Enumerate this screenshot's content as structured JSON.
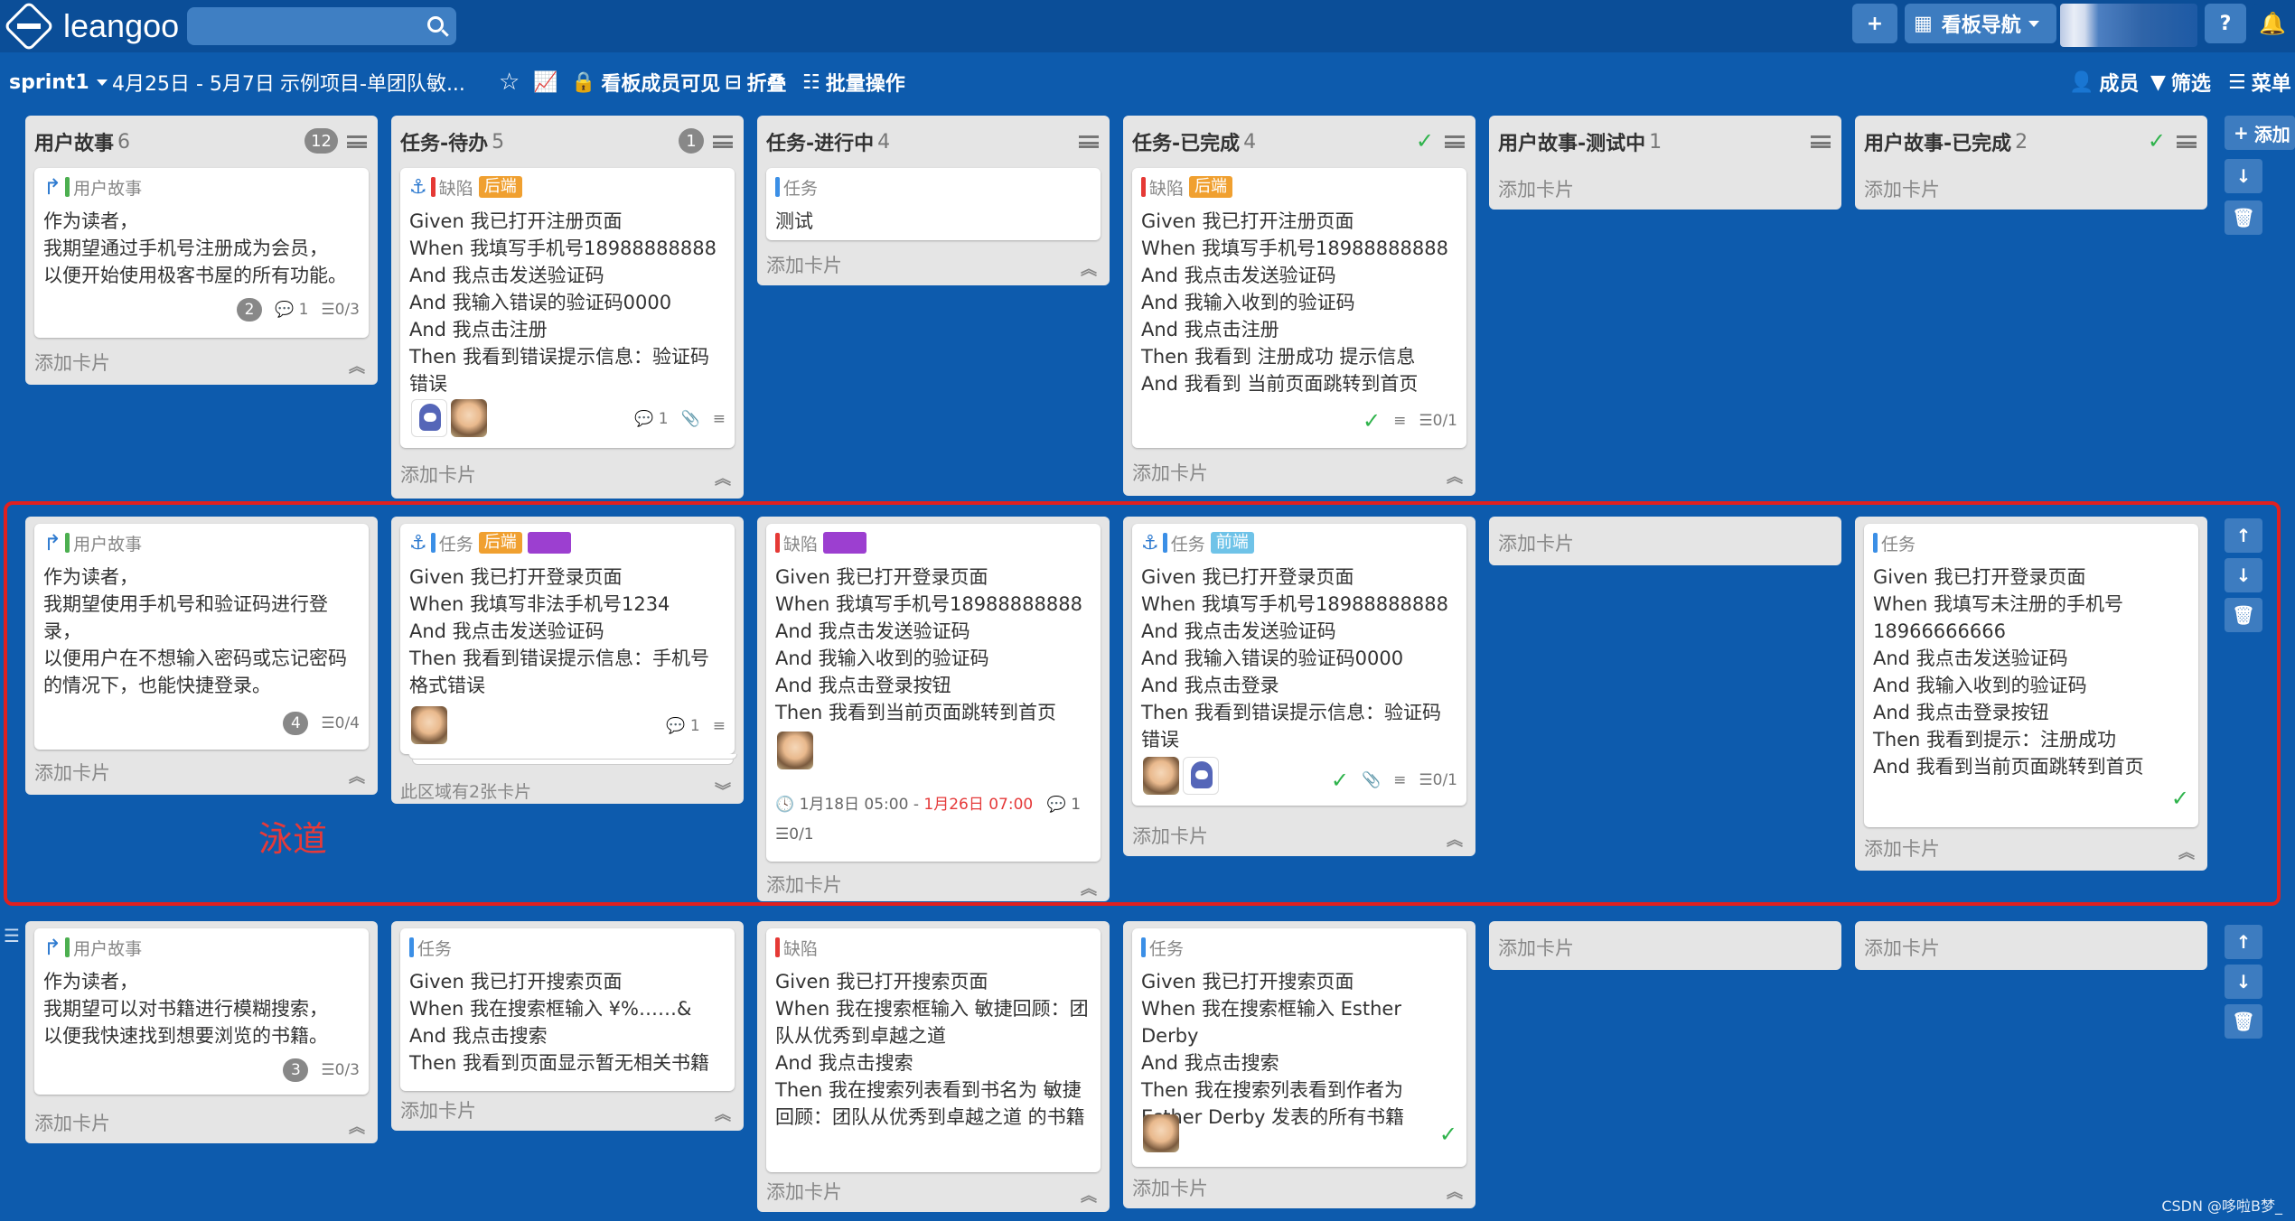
{
  "app": {
    "logo_text": "leangoo"
  },
  "topbar": {
    "add_label": "+",
    "grid_label": "▦",
    "nav_label": "看板导航",
    "help_label": "?",
    "bell_label": "🔔"
  },
  "board": {
    "sprint": "sprint1",
    "dates": "4月25日 - 5月7日",
    "project": "示例项目-单团队敏...",
    "star": "☆",
    "chart": "📈",
    "visibility": "看板成员可见",
    "fold": "折叠",
    "batch": "批量操作",
    "members": "成员",
    "filter": "筛选",
    "menu": "菜单"
  },
  "columns": [
    {
      "title": "用户故事",
      "count": "6",
      "badge": "12"
    },
    {
      "title": "任务-待办",
      "count": "5",
      "badge": "1"
    },
    {
      "title": "任务-进行中",
      "count": "4"
    },
    {
      "title": "任务-已完成",
      "count": "4",
      "check": "✓"
    },
    {
      "title": "用户故事-测试中",
      "count": "1"
    },
    {
      "title": "用户故事-已完成",
      "count": "2",
      "check": "✓"
    }
  ],
  "add_list": "添加",
  "add_card": "添加卡片",
  "collapsed_note": "此区域有2张卡片",
  "lane_label": "泳道",
  "lane1": {
    "c1": {
      "tag": "用户故事",
      "text": "作为读者，\n我期望通过手机号注册成为会员，\n以便开始使用极客书屋的所有功能。",
      "badge": "2",
      "comments": "1",
      "check": "0/3"
    },
    "c2": {
      "tag": "缺陷",
      "label": "后端",
      "text": "Given 我已打开注册页面\nWhen 我填写手机号18988888888\nAnd 我点击发送验证码\nAnd 我输入错误的验证码0000\nAnd 我点击注册\nThen 我看到错误提示信息：验证码错误",
      "comments": "1"
    },
    "c3": {
      "tag": "任务",
      "text": "测试"
    },
    "c4": {
      "tag": "缺陷",
      "label": "后端",
      "text": "Given 我已打开注册页面\nWhen 我填写手机号18988888888\nAnd 我点击发送验证码\nAnd 我输入收到的验证码\nAnd 我点击注册\nThen 我看到 注册成功 提示信息\nAnd 我看到 当前页面跳转到首页",
      "check": "0/1"
    }
  },
  "lane2": {
    "c1": {
      "tag": "用户故事",
      "text": "作为读者，\n我期望使用手机号和验证码进行登录，\n以便用户在不想输入密码或忘记密码的情况下，也能快捷登录。",
      "badge": "4",
      "check": "0/4"
    },
    "c2": {
      "tag": "任务",
      "label": "后端",
      "text": "Given 我已打开登录页面\nWhen 我填写非法手机号1234\nAnd 我点击发送验证码\nThen 我看到错误提示信息：手机号格式错误",
      "comments": "1"
    },
    "c3": {
      "tag": "缺陷",
      "text": "Given 我已打开登录页面\nWhen 我填写手机号18988888888\nAnd 我点击发送验证码\nAnd 我输入收到的验证码\nAnd 我点击登录按钮\nThen 我看到当前页面跳转到首页",
      "start": "1月18日 05:00",
      "sep": " - ",
      "due": "1月26日 07:00",
      "comments": "1",
      "check": "0/1"
    },
    "c4": {
      "tag": "任务",
      "label": "前端",
      "text": "Given 我已打开登录页面\nWhen 我填写手机号18988888888\nAnd 我点击发送验证码\nAnd 我输入错误的验证码0000\nAnd 我点击登录\nThen 我看到错误提示信息：验证码错误",
      "check": "0/1"
    },
    "c6": {
      "tag": "任务",
      "text": "Given 我已打开登录页面\nWhen 我填写未注册的手机号18966666666\nAnd 我点击发送验证码\nAnd 我输入收到的验证码\nAnd 我点击登录按钮\nThen 我看到提示：注册成功\nAnd 我看到当前页面跳转到首页"
    }
  },
  "lane3": {
    "c1": {
      "tag": "用户故事",
      "text": "作为读者，\n我期望可以对书籍进行模糊搜索，\n以便我快速找到想要浏览的书籍。",
      "badge": "3",
      "check": "0/3"
    },
    "c2": {
      "tag": "任务",
      "text": "Given 我已打开搜索页面\nWhen 我在搜索框输入 ¥%……&\nAnd 我点击搜索\nThen 我看到页面显示暂无相关书籍"
    },
    "c3": {
      "tag": "缺陷",
      "text": "Given 我已打开搜索页面\nWhen 我在搜索框输入 敏捷回顾：团队从优秀到卓越之道\nAnd 我点击搜索\nThen 我在搜索列表看到书名为 敏捷回顾：团队从优秀到卓越之道 的书籍"
    },
    "c4": {
      "tag": "任务",
      "text": "Given 我已打开搜索页面\nWhen 我在搜索框输入 Esther Derby\nAnd 我点击搜索\nThen 我在搜索列表看到作者为 Esther Derby 发表的所有书籍"
    }
  },
  "watermark": "CSDN @哆啦B梦_",
  "colors": {
    "story": "#4caf50",
    "task": "#3b8fe6",
    "bug": "#e53935",
    "backend": "#f0a030",
    "frontend": "#6fc3e8",
    "purple": "#9c3fd0"
  }
}
